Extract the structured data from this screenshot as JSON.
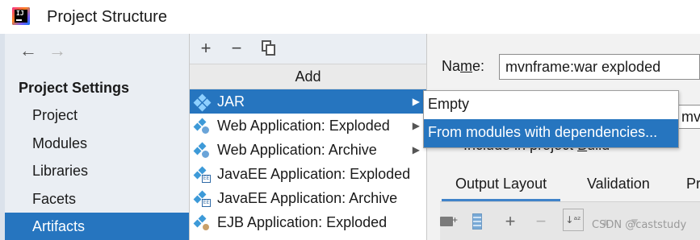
{
  "window": {
    "title": "Project Structure",
    "app_icon": "intellij-logo",
    "icon_text": "IJ"
  },
  "nav": {
    "back_glyph": "←",
    "forward_glyph": "→"
  },
  "sidebar": {
    "section_title": "Project Settings",
    "items": [
      {
        "label": "Project",
        "selected": false
      },
      {
        "label": "Modules",
        "selected": false
      },
      {
        "label": "Libraries",
        "selected": false
      },
      {
        "label": "Facets",
        "selected": false
      },
      {
        "label": "Artifacts",
        "selected": true
      }
    ]
  },
  "toolbar": {
    "add_glyph": "+",
    "remove_glyph": "−"
  },
  "add_menu": {
    "header": "Add",
    "items": [
      {
        "label": "JAR",
        "icon": "artifact-icon",
        "has_submenu": true,
        "selected": true
      },
      {
        "label": "Web Application: Exploded",
        "icon": "web-artifact-icon",
        "has_submenu": true,
        "selected": false
      },
      {
        "label": "Web Application: Archive",
        "icon": "web-artifact-icon",
        "has_submenu": true,
        "selected": false
      },
      {
        "label": "JavaEE Application: Exploded",
        "icon": "javaee-artifact-icon",
        "has_submenu": false,
        "selected": false
      },
      {
        "label": "JavaEE Application: Archive",
        "icon": "javaee-artifact-icon",
        "has_submenu": false,
        "selected": false
      },
      {
        "label": "EJB Application: Exploded",
        "icon": "ejb-artifact-icon",
        "has_submenu": false,
        "selected": false
      }
    ]
  },
  "submenu": {
    "items": [
      {
        "label": "Empty",
        "selected": false
      },
      {
        "label": "From modules with dependencies...",
        "selected": true
      }
    ]
  },
  "right_panel": {
    "name_label_pre": "Na",
    "name_label_u": "m",
    "name_label_post": "e:",
    "name_value": "mvnframe:war exploded",
    "type_value_partial": "mvn",
    "include_pre": "Include in project ",
    "include_u": "B",
    "include_post": "uild",
    "tabs": [
      {
        "label": "Output Layout",
        "active": true
      },
      {
        "label": "Validation",
        "active": false
      },
      {
        "label": "Pr",
        "active": false
      }
    ],
    "strip_add_glyph": "+",
    "strip_remove_glyph": "−",
    "sort_glyph": "↓ᵃᶻ",
    "up_glyph": "▲",
    "down_glyph": "▼"
  },
  "watermark": "CSDN @caststudy",
  "colors": {
    "selection": "#2675bf",
    "sidebar_bg": "#eaeef3",
    "tab_underline": "#4083c9"
  }
}
